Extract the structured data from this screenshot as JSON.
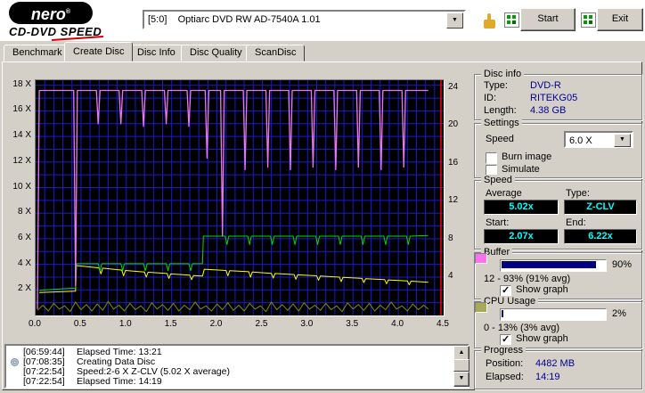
{
  "app": {
    "logo_line1": "nero",
    "logo_reg": "®",
    "logo_line2": "CD-DVD SPEED",
    "drive_combo": "[5:0]    Optiarc DVD RW AD-7540A 1.01",
    "start_label": "Start",
    "exit_label": "Exit"
  },
  "tabs": [
    {
      "label": "Benchmark"
    },
    {
      "label": "Create Disc"
    },
    {
      "label": "Disc Info"
    },
    {
      "label": "Disc Quality"
    },
    {
      "label": "ScanDisc"
    }
  ],
  "disc_info": {
    "title": "Disc info",
    "type_label": "Type:",
    "type_value": "DVD-R",
    "id_label": "ID:",
    "id_value": "RITEKG05",
    "length_label": "Length:",
    "length_value": "4.38 GB"
  },
  "settings": {
    "title": "Settings",
    "speed_label": "Speed",
    "speed_value": "6.0 X",
    "burn_image_label": "Burn image",
    "simulate_label": "Simulate"
  },
  "speed": {
    "title": "Speed",
    "average_label": "Average",
    "average_value": "5.02x",
    "type_label": "Type:",
    "type_value": "Z-CLV",
    "start_label": "Start:",
    "start_value": "2.07x",
    "end_label": "End:",
    "end_value": "6.22x"
  },
  "buffer": {
    "title": "Buffer",
    "percent": "90%",
    "range_text": "12 - 93% (91% avg)",
    "show_graph_label": "Show graph",
    "swatch_css": "background:#ff70f0",
    "fill_css": "width:90%"
  },
  "cpu": {
    "title": "CPU Usage",
    "percent": "2%",
    "range_text": "0 - 13% (3% avg)",
    "show_graph_label": "Show graph",
    "swatch_css": "background:#a8a858",
    "fill_css": "width:2%"
  },
  "progress": {
    "title": "Progress",
    "position_label": "Position:",
    "position_value": "4482 MB",
    "elapsed_label": "Elapsed:",
    "elapsed_value": "14:19"
  },
  "log": {
    "rows": [
      {
        "time": "[06:59:44]",
        "text": "Elapsed Time: 13:21"
      },
      {
        "time": "[07:08:35]",
        "text": "Creating Data Disc"
      },
      {
        "time": "[07:22:54]",
        "text": "Speed:2-6 X Z-CLV (5.02 X average)"
      },
      {
        "time": "[07:22:54]",
        "text": "Elapsed Time: 14:19"
      }
    ]
  },
  "chart_data": {
    "type": "line",
    "title": "",
    "x_axis": {
      "min": 0,
      "max": 4.5,
      "ticks": [
        0,
        0.5,
        1.0,
        1.5,
        2.0,
        2.5,
        3.0,
        3.5,
        4.0,
        4.5
      ],
      "tick_labels": [
        "0.0",
        "0.5",
        "1.0",
        "1.5",
        "2.0",
        "2.5",
        "3.0",
        "3.5",
        "4.0",
        "4.5"
      ]
    },
    "left_axis": {
      "min": 0,
      "max": 18.4,
      "ticks": [
        18,
        16,
        14,
        12,
        10,
        8,
        6,
        4,
        2
      ],
      "tick_labels": [
        "18 X",
        "16 X",
        "14 X",
        "12 X",
        "10 X",
        "8 X",
        "6 X",
        "4 X",
        "2 X"
      ]
    },
    "right_axis": {
      "min": 0,
      "max": 24.8,
      "ticks": [
        24,
        20,
        16,
        12,
        8,
        4
      ],
      "tick_labels": [
        "24",
        "20",
        "16",
        "12",
        "8",
        "4"
      ]
    },
    "grid": {
      "x_step": 0.1,
      "y_step": 1,
      "color": "#1a1ad0"
    },
    "end_marker": {
      "x": 4.47,
      "color": "#ff0000"
    },
    "series": [
      {
        "name": "cpu-usage",
        "color": "#8b8b00",
        "width": 1,
        "points": [
          [
            0.02,
            0.4
          ],
          [
            0.08,
            0.8
          ],
          [
            0.14,
            0.35
          ],
          [
            0.2,
            0.95
          ],
          [
            0.26,
            0.5
          ],
          [
            0.32,
            0.75
          ],
          [
            0.38,
            0.3
          ],
          [
            0.44,
            1.05
          ],
          [
            0.5,
            0.45
          ],
          [
            0.56,
            0.85
          ],
          [
            0.62,
            0.35
          ],
          [
            0.68,
            0.9
          ],
          [
            0.74,
            0.4
          ],
          [
            0.8,
            1.1
          ],
          [
            0.86,
            0.5
          ],
          [
            0.92,
            0.8
          ],
          [
            0.98,
            0.35
          ],
          [
            1.04,
            0.95
          ],
          [
            1.1,
            0.45
          ],
          [
            1.16,
            0.75
          ],
          [
            1.22,
            0.3
          ],
          [
            1.28,
            1.0
          ],
          [
            1.34,
            0.5
          ],
          [
            1.4,
            0.85
          ],
          [
            1.46,
            0.4
          ],
          [
            1.52,
            0.95
          ],
          [
            1.58,
            0.35
          ],
          [
            1.64,
            0.8
          ],
          [
            1.7,
            0.45
          ],
          [
            1.76,
            1.05
          ],
          [
            1.82,
            0.5
          ],
          [
            1.88,
            0.75
          ],
          [
            1.94,
            0.35
          ],
          [
            2.0,
            0.9
          ],
          [
            2.06,
            0.45
          ],
          [
            2.12,
            1.0
          ],
          [
            2.18,
            0.4
          ],
          [
            2.24,
            0.8
          ],
          [
            2.3,
            0.35
          ],
          [
            2.36,
            0.95
          ],
          [
            2.42,
            0.5
          ],
          [
            2.48,
            0.75
          ],
          [
            2.54,
            0.3
          ],
          [
            2.6,
            1.05
          ],
          [
            2.66,
            0.45
          ],
          [
            2.72,
            0.85
          ],
          [
            2.78,
            0.4
          ],
          [
            2.84,
            0.9
          ],
          [
            2.9,
            0.35
          ],
          [
            2.96,
            1.0
          ],
          [
            3.02,
            0.5
          ],
          [
            3.08,
            0.8
          ],
          [
            3.14,
            0.4
          ],
          [
            3.2,
            0.95
          ],
          [
            3.26,
            0.45
          ],
          [
            3.32,
            0.75
          ],
          [
            3.38,
            0.3
          ],
          [
            3.44,
            1.0
          ],
          [
            3.5,
            0.5
          ],
          [
            3.56,
            0.85
          ],
          [
            3.62,
            0.4
          ],
          [
            3.68,
            0.95
          ],
          [
            3.74,
            0.35
          ],
          [
            3.8,
            0.8
          ],
          [
            3.86,
            0.45
          ],
          [
            3.92,
            1.05
          ],
          [
            3.98,
            0.5
          ],
          [
            4.04,
            0.75
          ],
          [
            4.1,
            0.35
          ],
          [
            4.16,
            0.9
          ],
          [
            4.22,
            0.45
          ],
          [
            4.28,
            0.8
          ],
          [
            4.33,
            0.5
          ]
        ]
      },
      {
        "name": "rotation-speed",
        "color": "#ffff00",
        "width": 1,
        "points": [
          [
            0.04,
            1.8
          ],
          [
            0.44,
            1.9
          ],
          [
            0.45,
            3.9
          ],
          [
            0.7,
            3.72
          ],
          [
            0.72,
            3.25
          ],
          [
            0.74,
            3.7
          ],
          [
            0.95,
            3.55
          ],
          [
            0.97,
            3.1
          ],
          [
            0.99,
            3.52
          ],
          [
            1.2,
            3.4
          ],
          [
            1.22,
            3.0
          ],
          [
            1.24,
            3.38
          ],
          [
            1.45,
            3.28
          ],
          [
            1.47,
            2.9
          ],
          [
            1.49,
            3.25
          ],
          [
            1.7,
            3.15
          ],
          [
            1.72,
            2.8
          ],
          [
            1.74,
            3.12
          ],
          [
            1.84,
            3.08
          ],
          [
            1.86,
            3.62
          ],
          [
            2.1,
            3.52
          ],
          [
            2.12,
            3.1
          ],
          [
            2.14,
            3.5
          ],
          [
            2.35,
            3.42
          ],
          [
            2.37,
            3.0
          ],
          [
            2.39,
            3.4
          ],
          [
            2.6,
            3.3
          ],
          [
            2.62,
            2.92
          ],
          [
            2.64,
            3.28
          ],
          [
            2.85,
            3.2
          ],
          [
            2.87,
            2.82
          ],
          [
            2.89,
            3.18
          ],
          [
            3.1,
            3.1
          ],
          [
            3.12,
            2.75
          ],
          [
            3.14,
            3.08
          ],
          [
            3.35,
            3.0
          ],
          [
            3.37,
            2.65
          ],
          [
            3.39,
            2.98
          ],
          [
            3.6,
            2.9
          ],
          [
            3.62,
            2.58
          ],
          [
            3.64,
            2.88
          ],
          [
            3.85,
            2.8
          ],
          [
            3.87,
            2.48
          ],
          [
            3.89,
            2.78
          ],
          [
            4.1,
            2.7
          ],
          [
            4.12,
            2.4
          ],
          [
            4.14,
            2.68
          ],
          [
            4.33,
            2.6
          ]
        ]
      },
      {
        "name": "write-speed",
        "color": "#00dd00",
        "width": 1,
        "points": [
          [
            0.04,
            1.95
          ],
          [
            0.2,
            2.05
          ],
          [
            0.44,
            2.15
          ],
          [
            0.45,
            4.05
          ],
          [
            0.69,
            4.05
          ],
          [
            0.71,
            3.5
          ],
          [
            0.73,
            4.05
          ],
          [
            0.94,
            4.05
          ],
          [
            0.96,
            3.5
          ],
          [
            0.98,
            4.05
          ],
          [
            1.19,
            4.05
          ],
          [
            1.21,
            3.5
          ],
          [
            1.23,
            4.05
          ],
          [
            1.44,
            4.05
          ],
          [
            1.46,
            3.5
          ],
          [
            1.48,
            4.05
          ],
          [
            1.69,
            4.05
          ],
          [
            1.71,
            3.5
          ],
          [
            1.73,
            4.05
          ],
          [
            1.84,
            4.05
          ],
          [
            1.85,
            6.2
          ],
          [
            2.09,
            6.2
          ],
          [
            2.11,
            5.55
          ],
          [
            2.13,
            6.2
          ],
          [
            2.34,
            6.2
          ],
          [
            2.36,
            5.55
          ],
          [
            2.38,
            6.2
          ],
          [
            2.59,
            6.2
          ],
          [
            2.61,
            5.55
          ],
          [
            2.63,
            6.2
          ],
          [
            2.84,
            6.2
          ],
          [
            2.86,
            5.55
          ],
          [
            2.88,
            6.2
          ],
          [
            3.09,
            6.2
          ],
          [
            3.11,
            5.55
          ],
          [
            3.13,
            6.2
          ],
          [
            3.34,
            6.2
          ],
          [
            3.36,
            5.55
          ],
          [
            3.38,
            6.2
          ],
          [
            3.59,
            6.2
          ],
          [
            3.61,
            5.55
          ],
          [
            3.63,
            6.2
          ],
          [
            3.84,
            6.2
          ],
          [
            3.86,
            5.55
          ],
          [
            3.88,
            6.2
          ],
          [
            4.09,
            6.2
          ],
          [
            4.11,
            5.55
          ],
          [
            4.13,
            6.2
          ],
          [
            4.33,
            6.25
          ]
        ]
      },
      {
        "name": "buffer-level",
        "color": "#e878f0",
        "width": 1.3,
        "points": [
          [
            0.02,
            0.5
          ],
          [
            0.04,
            17.6
          ],
          [
            0.42,
            17.6
          ],
          [
            0.44,
            2.3
          ],
          [
            0.46,
            17.6
          ],
          [
            0.67,
            17.6
          ],
          [
            0.69,
            15.0
          ],
          [
            0.71,
            17.6
          ],
          [
            0.92,
            17.6
          ],
          [
            0.94,
            15.0
          ],
          [
            0.96,
            17.6
          ],
          [
            1.17,
            17.6
          ],
          [
            1.19,
            14.8
          ],
          [
            1.21,
            17.6
          ],
          [
            1.42,
            17.6
          ],
          [
            1.44,
            15.0
          ],
          [
            1.46,
            17.6
          ],
          [
            1.67,
            17.6
          ],
          [
            1.69,
            14.8
          ],
          [
            1.71,
            17.6
          ],
          [
            1.87,
            17.6
          ],
          [
            1.89,
            12.3
          ],
          [
            1.91,
            17.6
          ],
          [
            2.04,
            17.6
          ],
          [
            2.06,
            6.2
          ],
          [
            2.08,
            17.6
          ],
          [
            2.29,
            17.6
          ],
          [
            2.31,
            11.4
          ],
          [
            2.33,
            17.6
          ],
          [
            2.54,
            17.6
          ],
          [
            2.56,
            11.6
          ],
          [
            2.58,
            17.6
          ],
          [
            2.79,
            17.6
          ],
          [
            2.81,
            11.4
          ],
          [
            2.83,
            17.6
          ],
          [
            3.04,
            17.6
          ],
          [
            3.06,
            11.6
          ],
          [
            3.08,
            17.6
          ],
          [
            3.29,
            17.6
          ],
          [
            3.31,
            11.4
          ],
          [
            3.33,
            17.6
          ],
          [
            3.54,
            17.6
          ],
          [
            3.56,
            11.6
          ],
          [
            3.58,
            17.6
          ],
          [
            3.79,
            17.6
          ],
          [
            3.81,
            11.4
          ],
          [
            3.83,
            17.6
          ],
          [
            4.04,
            17.6
          ],
          [
            4.06,
            11.6
          ],
          [
            4.08,
            17.6
          ],
          [
            4.3,
            17.6
          ],
          [
            4.33,
            17.6
          ]
        ]
      }
    ]
  }
}
